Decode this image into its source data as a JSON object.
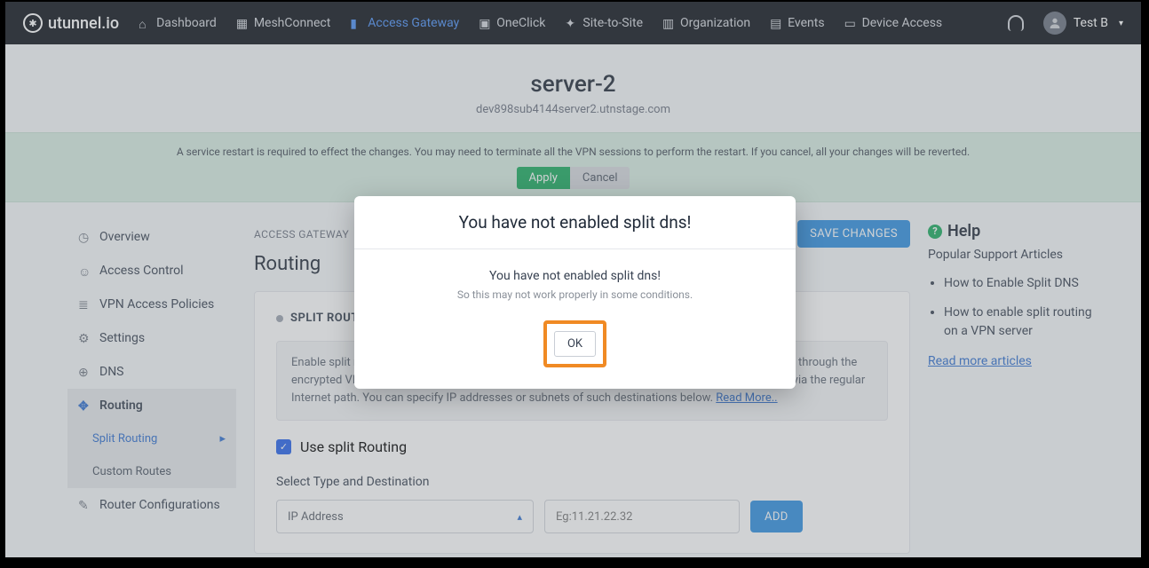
{
  "brand": "utunnel.io",
  "nav": {
    "dashboard": "Dashboard",
    "meshconnect": "MeshConnect",
    "access_gateway": "Access Gateway",
    "oneclick": "OneClick",
    "site_to_site": "Site-to-Site",
    "organization": "Organization",
    "events": "Events",
    "device_access": "Device Access"
  },
  "user": {
    "name": "Test B"
  },
  "page": {
    "title": "server-2",
    "subdomain": "dev898sub4144server2.utnstage.com"
  },
  "banner": {
    "text": "A service restart is required to effect the changes. You may need to terminate all the VPN sessions to perform the restart. If you cancel, all your changes will be reverted.",
    "apply": "Apply",
    "cancel": "Cancel"
  },
  "sidebar": {
    "overview": "Overview",
    "access_control": "Access Control",
    "vpn_policies": "VPN Access Policies",
    "settings": "Settings",
    "dns": "DNS",
    "routing": "Routing",
    "split_routing": "Split Routing",
    "custom_routes": "Custom Routes",
    "router_config": "Router Configurations"
  },
  "crumbs": {
    "a": "ACCESS GATEWAY",
    "sep": "/"
  },
  "save_changes": "SAVE CHANGES",
  "section": "Routing",
  "card": {
    "title": "SPLIT ROUTING",
    "info": "Enable split routing to direct traffic from your VPN client devices solely to the selected destinations through the encrypted VPN tunnel when connected to this VPN Gateway. All other traffic will be routed directly via the regular Internet path. You can specify IP addresses or subnets of such destinations below. ",
    "read_more": "Read More..",
    "use_split": "Use split Routing",
    "select_label": "Select Type and Destination",
    "type_value": "IP Address",
    "dest_placeholder": "Eg:11.21.22.32",
    "add": "ADD"
  },
  "help": {
    "title": "Help",
    "subtitle": "Popular Support Articles",
    "a1": "How to Enable Split DNS",
    "a2": "How to enable split routing on a VPN server",
    "more": "Read more articles"
  },
  "modal": {
    "title": "You have not enabled split dns!",
    "line1": "You have not enabled split dns!",
    "line2": "So this may not work properly in some conditions.",
    "ok": "OK"
  }
}
